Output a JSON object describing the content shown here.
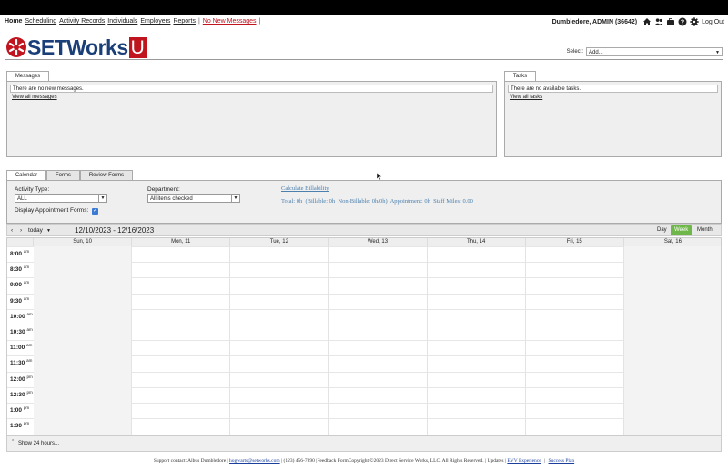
{
  "nav": {
    "items": [
      "Home",
      "Scheduling",
      "Activity Records",
      "Individuals",
      "Employers",
      "Reports"
    ],
    "alert": "No New Messages",
    "pipe": "|",
    "user": "Dumbledore, ADMIN (36642)",
    "logout": "Log Out"
  },
  "logo": {
    "text": "SETWorks",
    "u": "U"
  },
  "select": {
    "label": "Select:",
    "value": "Add..."
  },
  "messages": {
    "tab": "Messages",
    "empty": "There are no new messages.",
    "view_all": "View all messages"
  },
  "tasks": {
    "tab": "Tasks",
    "empty": "There are no available tasks.",
    "view_all": "View all tasks"
  },
  "cal_tabs": [
    "Calendar",
    "Forms",
    "Review Forms"
  ],
  "filters": {
    "activity_label": "Activity Type:",
    "activity_value": "ALL",
    "department_label": "Department:",
    "department_value": "All items checked",
    "display_label": "Display Appointment Forms:",
    "calc_link": "Calculate Billability",
    "totals": "Total: 0h  (Billable: 0h  Non-Billable: 0h/0h)  Appointment: 0h  Staff Miles: 0.00"
  },
  "toolbar": {
    "prev": "‹",
    "next": "›",
    "today": "today",
    "range": "12/10/2023 - 12/16/2023",
    "views": [
      "Day",
      "Week",
      "Month"
    ],
    "active_view": "Week"
  },
  "days": [
    "Sun, 10",
    "Mon, 11",
    "Tue, 12",
    "Wed, 13",
    "Thu, 14",
    "Fri, 15",
    "Sat, 16"
  ],
  "times": [
    {
      "t": "8:00",
      "ap": "am"
    },
    {
      "t": "8:30",
      "ap": "am"
    },
    {
      "t": "9:00",
      "ap": "am"
    },
    {
      "t": "9:30",
      "ap": "am"
    },
    {
      "t": "10:00",
      "ap": "am"
    },
    {
      "t": "10:30",
      "ap": "am"
    },
    {
      "t": "11:00",
      "ap": "am"
    },
    {
      "t": "11:30",
      "ap": "am"
    },
    {
      "t": "12:00",
      "ap": "pm"
    },
    {
      "t": "12:30",
      "ap": "pm"
    },
    {
      "t": "1:00",
      "ap": "pm"
    },
    {
      "t": "1:30",
      "ap": "pm"
    }
  ],
  "show24": "Show 24 hours...",
  "footer": {
    "support": "Support contact: Albus Dumbledore |",
    "email": "hogwarts@setworks.com",
    "middle": "| (123) 456-7890 |Feedback FormCopyright ©2023 Direct Service Works, LLC. All Rights Reserved. |  Updates  |",
    "evv": "EVV Experience",
    "bar": "|",
    "success": "Success Plan"
  },
  "colors": {
    "brand_blue": "#1a3f78",
    "brand_red": "#c0141e",
    "week_green": "#6fb74a"
  }
}
